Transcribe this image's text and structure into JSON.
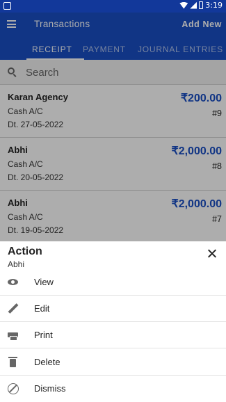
{
  "status_bar": {
    "time": "3:19"
  },
  "app_bar": {
    "title": "Transactions",
    "action_label": "Add New"
  },
  "tabs": [
    {
      "label": "RECEIPT",
      "active": true
    },
    {
      "label": "PAYMENT",
      "active": false
    },
    {
      "label": "JOURNAL ENTRIES",
      "active": false
    }
  ],
  "search": {
    "placeholder": "Search",
    "value": ""
  },
  "transactions": [
    {
      "party": "Karan Agency",
      "account": "Cash A/C",
      "date": "Dt. 27-05-2022",
      "amount": "₹200.00",
      "number": "#9"
    },
    {
      "party": "Abhi",
      "account": "Cash A/C",
      "date": "Dt. 20-05-2022",
      "amount": "₹2,000.00",
      "number": "#8"
    },
    {
      "party": "Abhi",
      "account": "Cash A/C",
      "date": "Dt. 19-05-2022",
      "amount": "₹2,000.00",
      "number": "#7"
    }
  ],
  "action_sheet": {
    "title": "Action",
    "subtitle": "Abhi",
    "items": [
      {
        "label": "View",
        "icon": "eye-icon"
      },
      {
        "label": "Edit",
        "icon": "pencil-icon"
      },
      {
        "label": "Print",
        "icon": "printer-icon"
      },
      {
        "label": "Delete",
        "icon": "trash-icon"
      },
      {
        "label": "Dismiss",
        "icon": "block-icon"
      }
    ]
  },
  "colors": {
    "primary": "#1a4fc4",
    "status_bar": "#12389a",
    "amount": "#1a4fc4"
  }
}
